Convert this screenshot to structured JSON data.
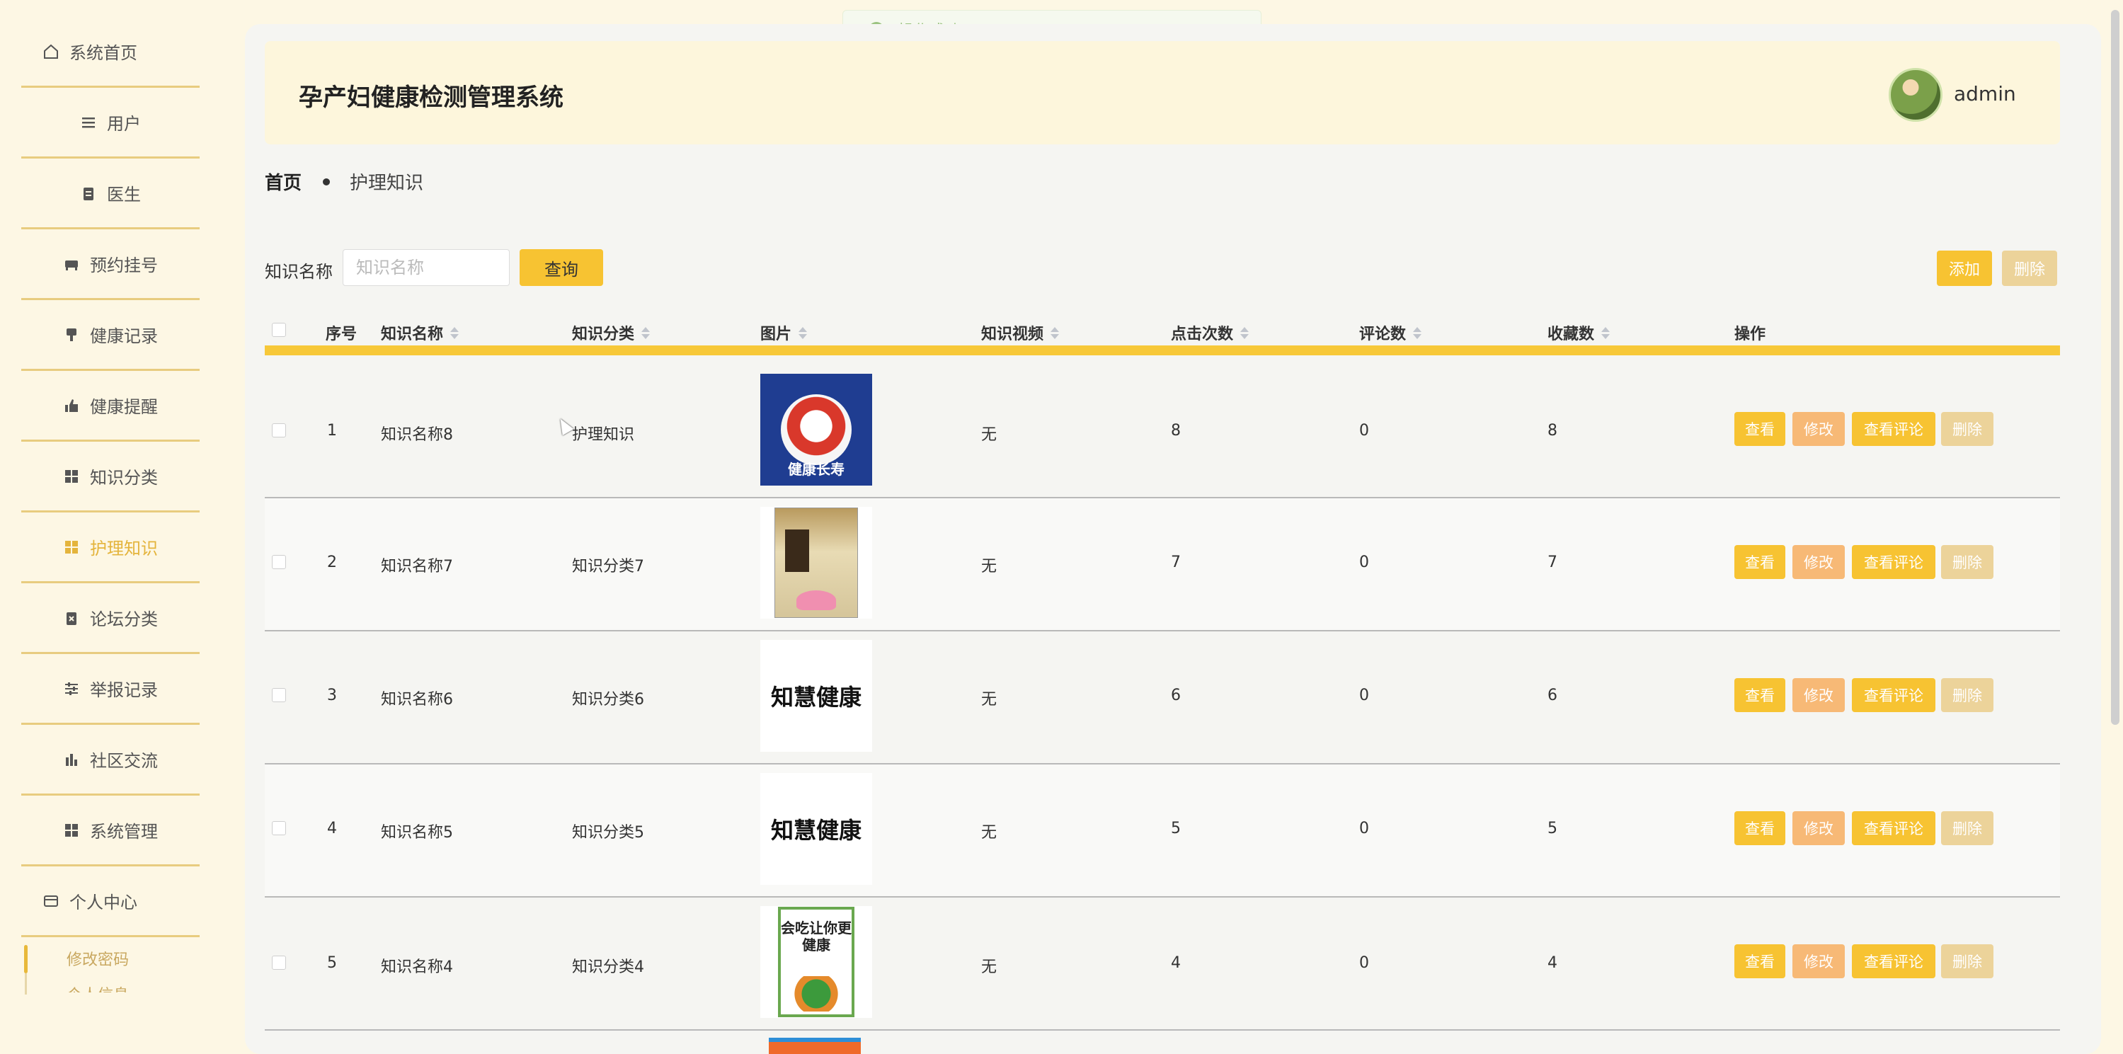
{
  "sidebar": {
    "items": [
      {
        "label": "系统首页",
        "icon": "home-icon"
      },
      {
        "label": "用户",
        "icon": "list-icon"
      },
      {
        "label": "医生",
        "icon": "clipboard-icon"
      },
      {
        "label": "预约挂号",
        "icon": "bed-icon"
      },
      {
        "label": "健康记录",
        "icon": "seat-icon"
      },
      {
        "label": "健康提醒",
        "icon": "thumb-icon"
      },
      {
        "label": "知识分类",
        "icon": "grid-icon"
      },
      {
        "label": "护理知识",
        "icon": "grid-icon"
      },
      {
        "label": "论坛分类",
        "icon": "clipboard-x-icon"
      },
      {
        "label": "举报记录",
        "icon": "sliders-icon"
      },
      {
        "label": "社区交流",
        "icon": "bar-chart-icon"
      },
      {
        "label": "系统管理",
        "icon": "grid-icon"
      },
      {
        "label": "个人中心",
        "icon": "card-icon"
      }
    ],
    "sub_items": [
      "修改密码",
      "个人信息"
    ],
    "active": "护理知识"
  },
  "header": {
    "title": "孕产妇健康检测管理系统",
    "user": "admin"
  },
  "toast": {
    "text": "操作成功"
  },
  "breadcrumb": {
    "home": "首页",
    "current": "护理知识"
  },
  "search": {
    "label": "知识名称",
    "placeholder": "知识名称",
    "query_label": "查询",
    "add_label": "添加",
    "delete_label": "删除"
  },
  "table": {
    "columns": [
      "序号",
      "知识名称",
      "知识分类",
      "图片",
      "知识视频",
      "点击次数",
      "评论数",
      "收藏数",
      "操作"
    ],
    "rows": [
      {
        "index": "1",
        "name": "知识名称8",
        "category": "护理知识",
        "image_text": "健康长寿",
        "video": "无",
        "clicks": "8",
        "comments": "0",
        "favorites": "8"
      },
      {
        "index": "2",
        "name": "知识名称7",
        "category": "知识分类7",
        "image_text": "",
        "video": "无",
        "clicks": "7",
        "comments": "0",
        "favorites": "7"
      },
      {
        "index": "3",
        "name": "知识名称6",
        "category": "知识分类6",
        "image_text": "知慧健康",
        "video": "无",
        "clicks": "6",
        "comments": "0",
        "favorites": "6"
      },
      {
        "index": "4",
        "name": "知识名称5",
        "category": "知识分类5",
        "image_text": "知慧健康",
        "video": "无",
        "clicks": "5",
        "comments": "0",
        "favorites": "5"
      },
      {
        "index": "5",
        "name": "知识名称4",
        "category": "知识分类4",
        "image_text": "会吃让你更健康",
        "video": "无",
        "clicks": "4",
        "comments": "0",
        "favorites": "4"
      }
    ],
    "actions": {
      "view": "查看",
      "edit": "修改",
      "comments": "查看评论",
      "delete": "删除"
    }
  },
  "colors": {
    "accent": "#f7c332",
    "edit": "#f7b976",
    "delete": "#ecd39a",
    "background": "#fdf7e4",
    "active_text": "#e4b43c"
  }
}
